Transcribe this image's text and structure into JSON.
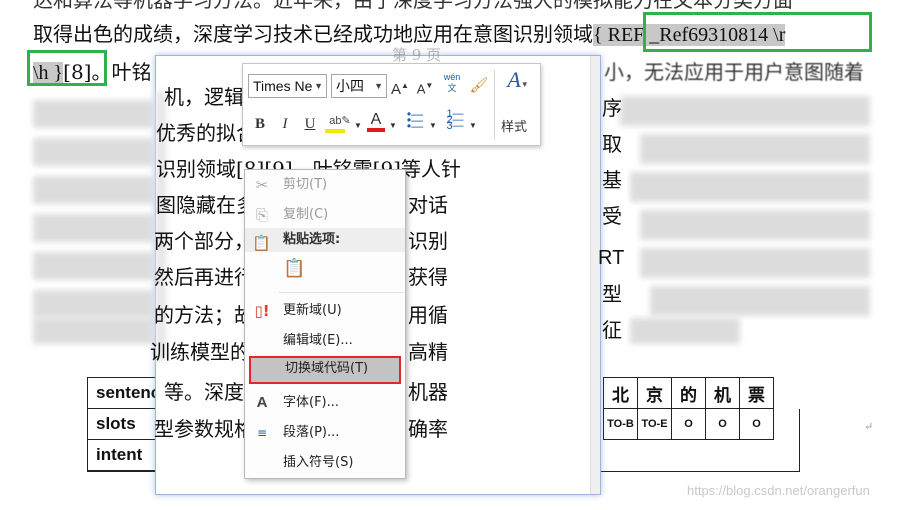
{
  "document": {
    "line1": "达和算法等机器学习方法。近年来，由于深度学习方法强大的模拟能力在文本分类方面",
    "line2_prefix": "取得出色的成绩，深度学习技术已经成功地应用在意图识别领域",
    "field_code_1": "{ REF _Ref69310814 \\r",
    "field_code_2": "\\h }",
    "line3_after": "[8]。叶铭",
    "right_fragment": "小，无法应用于用户意图随着",
    "table_labels": [
      "sentenc",
      "slots",
      "intent"
    ],
    "table_right_row1": [
      "北",
      "京",
      "的",
      "机",
      "票"
    ],
    "table_right_row2": [
      "TO-B",
      "TO-E",
      "O",
      "O",
      "O"
    ],
    "return_mark": "↵"
  },
  "popup": {
    "header_fragment": "第 9 页",
    "lines": [
      "机，逻辑",
      "优秀的拟合",
      "识别领域[8][9]。叶铭雷[9]等人针",
      "图隐藏在多",
      "两个部分，",
      "然后再进行",
      "的方法；故",
      "训练模型的",
      "等。深度",
      "型参数规格"
    ],
    "right_lines": [
      "序",
      "取",
      "基",
      "受",
      "RT",
      "型",
      "征"
    ],
    "mid_fragments": [
      "对话",
      "识别",
      "获得",
      "用循",
      "高精",
      "机器",
      "确率"
    ]
  },
  "mini_toolbar": {
    "font_name": "Times Ne",
    "font_size": "小四",
    "grow_font": "A",
    "shrink_font": "A",
    "phonetic": "wén 文",
    "bold": "B",
    "italic": "I",
    "underline": "U",
    "styles_label": "样式"
  },
  "context_menu": {
    "cut": "剪切(T)",
    "copy": "复制(C)",
    "paste_options": "粘贴选项:",
    "update_field": "更新域(U)",
    "edit_field": "编辑域(E)...",
    "toggle_field_codes": "切换域代码(T)",
    "font": "字体(F)...",
    "paragraph": "段落(P)...",
    "insert_symbol": "插入符号(S)"
  },
  "watermark": "https://blog.csdn.net/orangerfun",
  "colors": {
    "highlight_box": "#2fb24a",
    "menu_hot_border": "#e2262b",
    "highlighter_yellow": "#f7e600",
    "font_color_red": "#e0191f"
  }
}
